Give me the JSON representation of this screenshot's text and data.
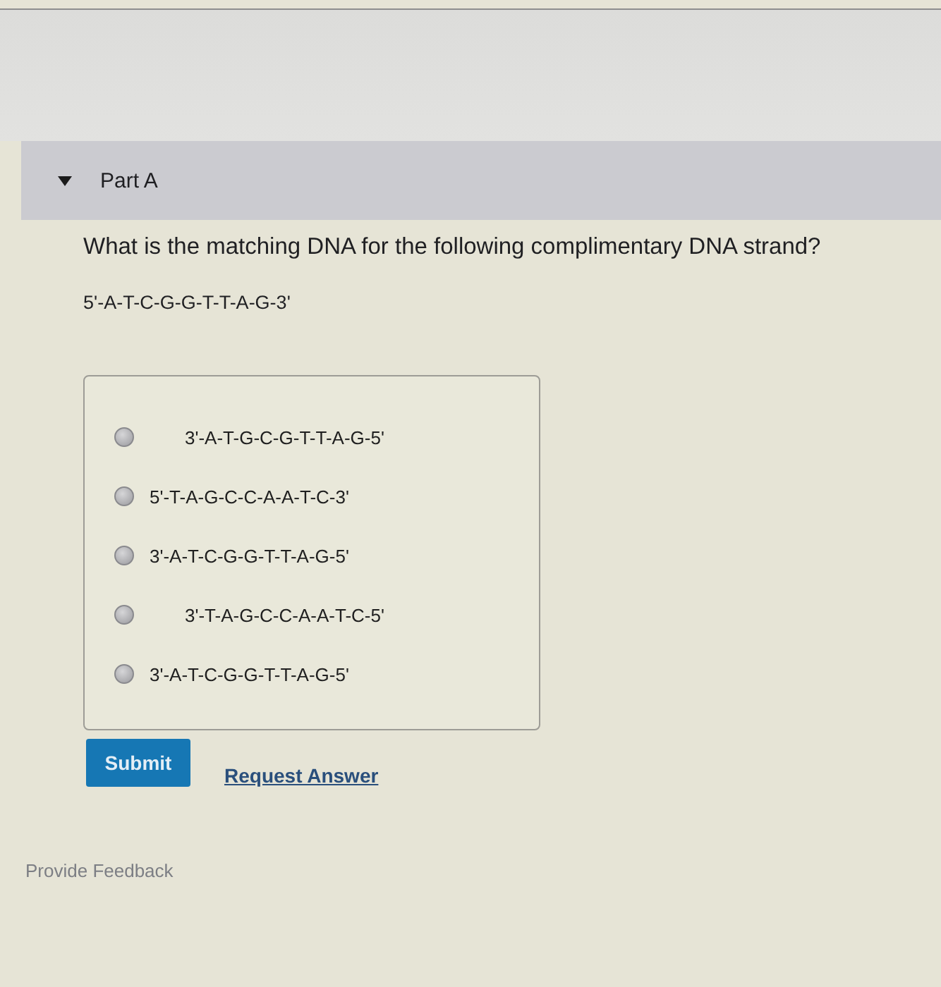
{
  "part": {
    "title": "Part A",
    "expanded": true
  },
  "question": {
    "text": "What is the matching DNA for the following complimentary DNA strand?",
    "strand": "5'-A-T-C-G-G-T-T-A-G-3'"
  },
  "options": [
    {
      "label": "3'-A-T-G-C-G-T-T-A-G-5'",
      "selected": false,
      "indented": true
    },
    {
      "label": "5'-T-A-G-C-C-A-A-T-C-3'",
      "selected": false,
      "indented": false
    },
    {
      "label": "3'-A-T-C-G-G-T-T-A-G-5'",
      "selected": false,
      "indented": false
    },
    {
      "label": "3'-T-A-G-C-C-A-A-T-C-5'",
      "selected": false,
      "indented": true
    },
    {
      "label": "3'-A-T-C-G-G-T-T-A-G-5'",
      "selected": false,
      "indented": false
    }
  ],
  "actions": {
    "submit": "Submit",
    "request": "Request Answer"
  },
  "feedback": "Provide Feedback"
}
